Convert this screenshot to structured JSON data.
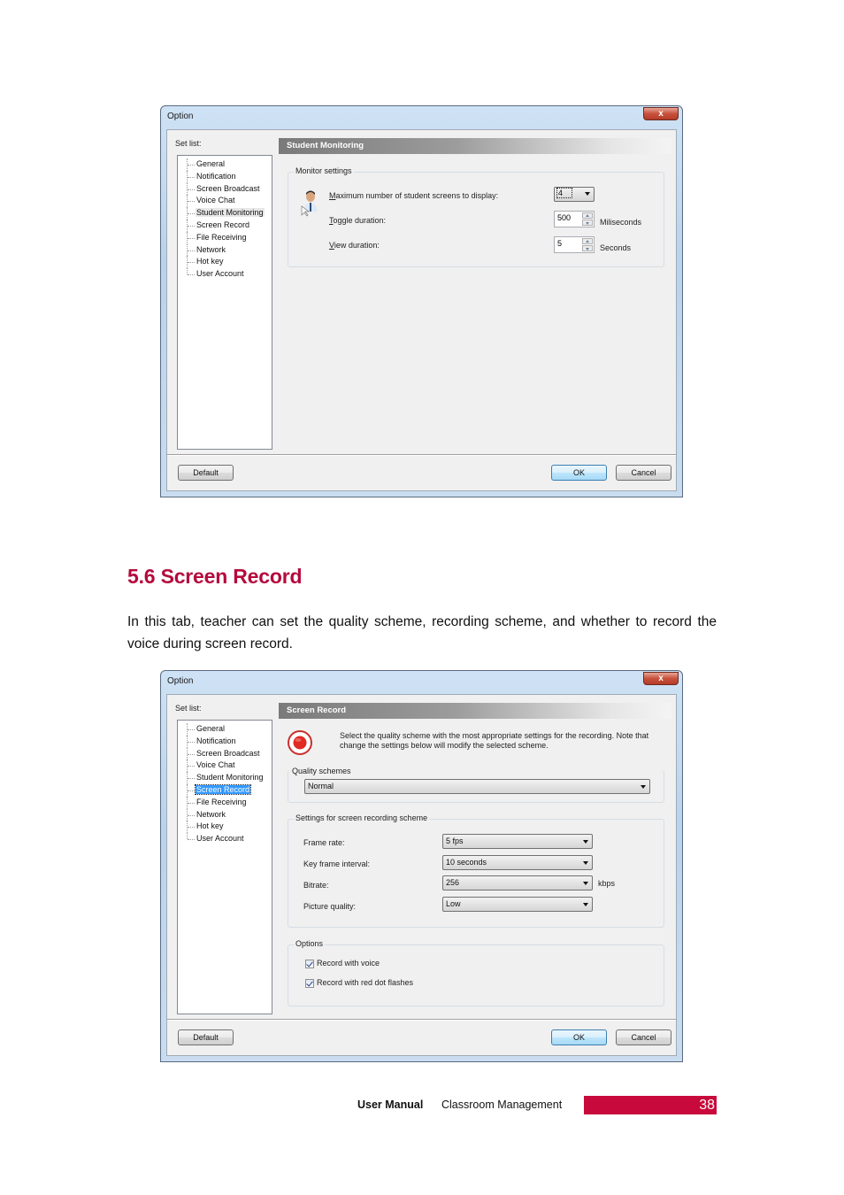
{
  "dialog1": {
    "title": "Option",
    "close_glyph": "x",
    "setlist_label": "Set list:",
    "tree_items": [
      "General",
      "Notification",
      "Screen Broadcast",
      "Voice Chat",
      "Student Monitoring",
      "Screen Record",
      "File Receiving",
      "Network",
      "Hot key",
      "User Account"
    ],
    "selected_item": "Student Monitoring",
    "panel_title": "Student Monitoring",
    "group_title": "Monitor settings",
    "icon": "student-monitor-icon",
    "rows": [
      {
        "label_key": "M",
        "label_rest": "aximum number of student screens to display:",
        "value": "4",
        "control": "combo"
      },
      {
        "label_key": "T",
        "label_rest": "oggle duration:",
        "value": "500",
        "unit": "Miliseconds",
        "control": "spin"
      },
      {
        "label_key": "V",
        "label_rest": "iew duration:",
        "value": "5",
        "unit": "Seconds",
        "control": "spin"
      }
    ],
    "buttons": {
      "default": "Default",
      "ok": "OK",
      "cancel": "Cancel"
    }
  },
  "section": {
    "heading": "5.6  Screen Record",
    "paragraph": "In this tab, teacher can set the quality scheme, recording scheme, and whether to record the voice during screen record."
  },
  "dialog2": {
    "title": "Option",
    "close_glyph": "x",
    "setlist_label": "Set list:",
    "tree_items": [
      "General",
      "Notification",
      "Screen Broadcast",
      "Voice Chat",
      "Student Monitoring",
      "Screen Record",
      "File Receiving",
      "Network",
      "Hot key",
      "User Account"
    ],
    "selected_item": "Screen Record",
    "panel_title": "Screen Record",
    "icon": "record-icon",
    "description": "Select the quality scheme with the most appropriate settings for the recording. Note that change the settings below will modify the selected scheme.",
    "quality_group_title": "Quality schemes",
    "quality_scheme": "Normal",
    "scheme_group_title": "Settings for screen recording scheme",
    "scheme_rows": [
      {
        "label": "Frame rate:",
        "value": "5 fps",
        "unit": ""
      },
      {
        "label": "Key frame interval:",
        "value": "10 seconds",
        "unit": ""
      },
      {
        "label": "Bitrate:",
        "value": "256",
        "unit": "kbps"
      },
      {
        "label": "Picture quality:",
        "value": "Low",
        "unit": ""
      }
    ],
    "options_group_title": "Options",
    "options": [
      {
        "label": "Record with voice",
        "checked": true
      },
      {
        "label": "Record with red dot flashes",
        "checked": true
      }
    ],
    "buttons": {
      "default": "Default",
      "ok": "OK",
      "cancel": "Cancel"
    }
  },
  "footer": {
    "bold": "User  Manual",
    "text": "Classroom  Management",
    "page_number": "38",
    "accent_color": "#c8093b"
  }
}
